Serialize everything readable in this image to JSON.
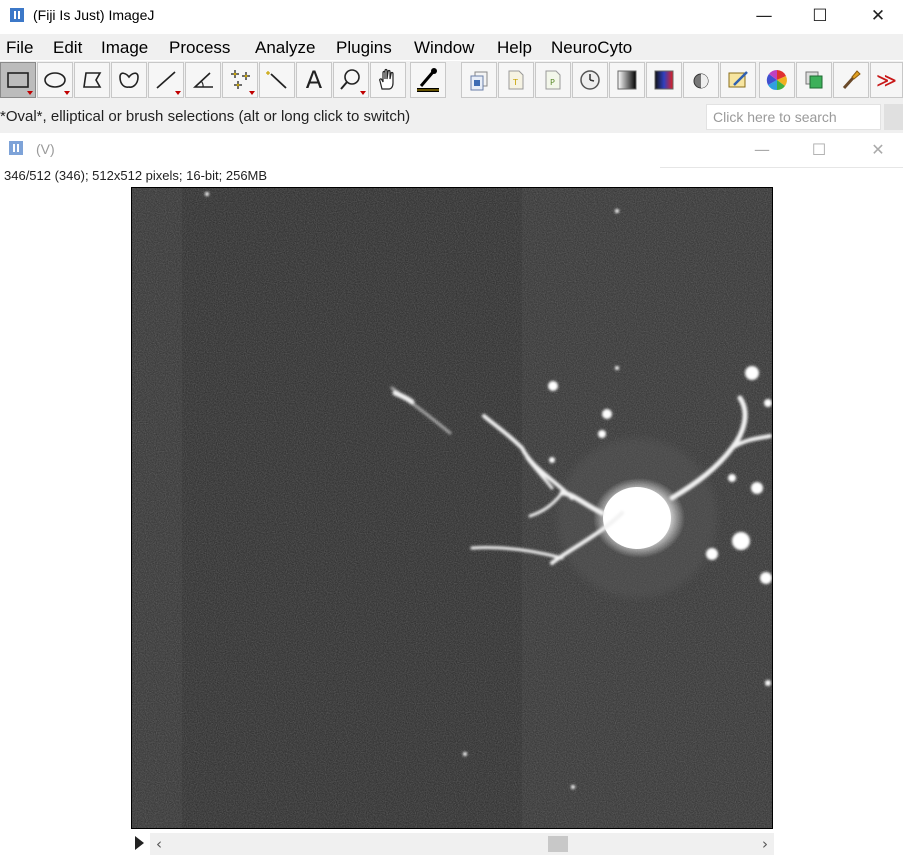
{
  "window": {
    "title": "(Fiji Is Just) ImageJ",
    "controls": {
      "minimize": "—",
      "maximize": "☐",
      "close": "✕"
    }
  },
  "menu": [
    "File",
    "Edit",
    "Image",
    "Process",
    "Analyze",
    "Plugins",
    "Window",
    "Help",
    "NeuroCyto"
  ],
  "toolbar": {
    "tools": [
      {
        "name": "rectangle-tool",
        "selected": true,
        "has_menu": true
      },
      {
        "name": "oval-tool",
        "selected": false,
        "has_menu": true
      },
      {
        "name": "polygon-tool",
        "selected": false,
        "has_menu": false
      },
      {
        "name": "freehand-tool",
        "selected": false,
        "has_menu": false
      },
      {
        "name": "line-tool",
        "selected": false,
        "has_menu": true
      },
      {
        "name": "angle-tool",
        "selected": false,
        "has_menu": false
      },
      {
        "name": "point-tool",
        "selected": false,
        "has_menu": true
      },
      {
        "name": "wand-tool",
        "selected": false,
        "has_menu": false
      },
      {
        "name": "text-tool",
        "selected": false,
        "has_menu": false
      },
      {
        "name": "magnifier-tool",
        "selected": false,
        "has_menu": true
      },
      {
        "name": "hand-tool",
        "selected": false,
        "has_menu": false
      },
      {
        "name": "color-picker-tool",
        "selected": false,
        "has_menu": false
      }
    ],
    "text_tool_glyph": "A",
    "more_glyph": "≫",
    "plugin_icons": [
      "stack-icon",
      "text-file-icon",
      "plugin-file-icon",
      "clock-icon",
      "gradient-icon",
      "lut-icon",
      "contrast-icon",
      "edit-image-icon",
      "color-wheel-icon",
      "layers-icon",
      "brush-icon"
    ]
  },
  "status": {
    "message": "*Oval*, elliptical or brush selections (alt or long click to switch)",
    "search_placeholder": "Click here to search"
  },
  "image_window": {
    "title": "(V)",
    "info": "346/512 (346); 512x512 pixels; 16-bit; 256MB",
    "controls": {
      "minimize": "—",
      "maximize": "☐",
      "close": "✕"
    }
  },
  "scrollbar": {
    "left_arrow": "‹",
    "right_arrow": "›"
  }
}
